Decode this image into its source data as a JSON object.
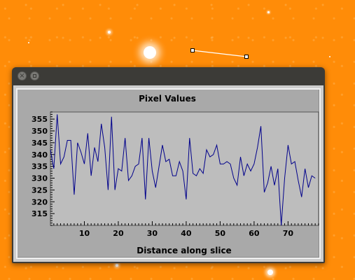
{
  "colors": {
    "background": "#ff8c08",
    "window_frame": "#3c3b37",
    "plot_area": "#bdbdbd",
    "series": "#00008b"
  },
  "titlebar": {
    "close_icon": "close-icon",
    "maximize_icon": "maximize-icon"
  },
  "chart_data": {
    "type": "line",
    "title": "Pixel Values",
    "xlabel": "Distance along slice",
    "ylabel": "",
    "xlim": [
      0,
      79
    ],
    "ylim": [
      310,
      358
    ],
    "xticks": [
      10,
      20,
      30,
      40,
      50,
      60,
      70
    ],
    "yticks": [
      315,
      320,
      325,
      330,
      335,
      340,
      345,
      350,
      355
    ],
    "grid": false,
    "series": [
      {
        "values": [
          342,
          334,
          357,
          336,
          339,
          346,
          346,
          323,
          345,
          341,
          336,
          349,
          331,
          343,
          337,
          353,
          343,
          325,
          356,
          325,
          334,
          333,
          347,
          329,
          331,
          335,
          336,
          347,
          321,
          347,
          333,
          326,
          335,
          344,
          337,
          338,
          331,
          331,
          337,
          333,
          321,
          347,
          332,
          331,
          334,
          332,
          342,
          339,
          340,
          344,
          336,
          336,
          337,
          336,
          330,
          327,
          339,
          331,
          336,
          333,
          336,
          343,
          352,
          324,
          328,
          335,
          327,
          334,
          310,
          330,
          344,
          336,
          337,
          329,
          322,
          334,
          326,
          331,
          330
        ]
      }
    ]
  }
}
